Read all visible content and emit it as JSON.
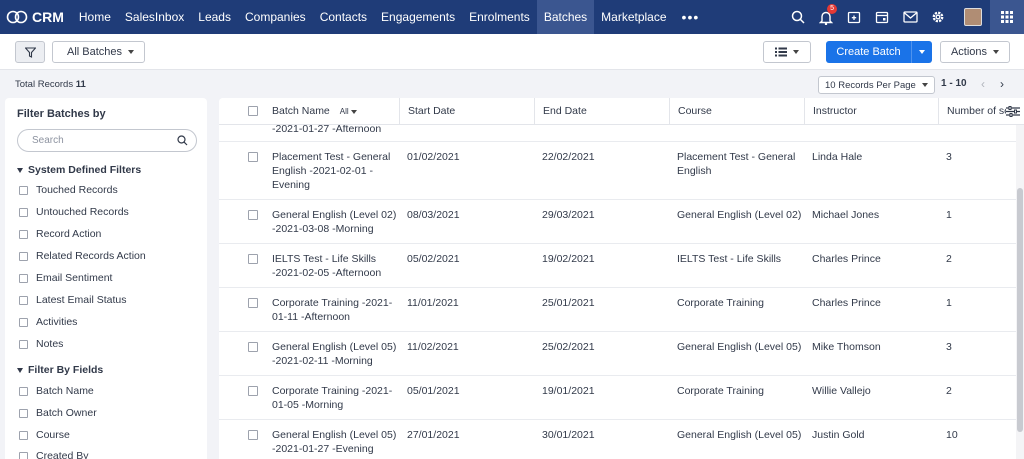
{
  "brand": {
    "name": "CRM"
  },
  "nav": {
    "items": [
      {
        "label": "Home",
        "active": false
      },
      {
        "label": "SalesInbox",
        "active": false
      },
      {
        "label": "Leads",
        "active": false
      },
      {
        "label": "Companies",
        "active": false
      },
      {
        "label": "Contacts",
        "active": false
      },
      {
        "label": "Engagements",
        "active": false
      },
      {
        "label": "Enrolments",
        "active": false
      },
      {
        "label": "Batches",
        "active": true
      },
      {
        "label": "Marketplace",
        "active": false
      }
    ],
    "more": "•••",
    "notification_count": "5",
    "icons": [
      "search-icon",
      "bell-icon",
      "add-calendar-icon",
      "calendar-icon",
      "mail-icon",
      "gear-icon",
      "avatar",
      "apps-grid-icon"
    ]
  },
  "toolbar": {
    "view_label": "All Batches",
    "create_label": "Create Batch",
    "actions_label": "Actions"
  },
  "subbar": {
    "total_label": "Total Records",
    "total_count": "11",
    "per_page": "10 Records Per Page",
    "range": "1 - 10"
  },
  "sidebar": {
    "title": "Filter Batches by",
    "search_placeholder": "Search",
    "group1": "System Defined Filters",
    "system_filters": [
      "Touched Records",
      "Untouched Records",
      "Record Action",
      "Related Records Action",
      "Email Sentiment",
      "Latest Email Status",
      "Activities",
      "Notes"
    ],
    "group2": "Filter By Fields",
    "field_filters": [
      "Batch Name",
      "Batch Owner",
      "Course",
      "Created By"
    ]
  },
  "table": {
    "columns": [
      "Batch Name",
      "Start Date",
      "End Date",
      "Course",
      "Instructor",
      "Number of se"
    ],
    "all_label": "All",
    "partial_row": "-2021-01-27 -Afternoon",
    "rows": [
      {
        "name1": "Placement Test - General",
        "name2": "English -2021-02-01 -",
        "name3": "Evening",
        "start": "01/02/2021",
        "end": "22/02/2021",
        "course1": "Placement Test - General",
        "course2": "English",
        "instructor": "Linda Hale",
        "sessions": "3"
      },
      {
        "name1": "General English (Level 02)",
        "name2": "-2021-03-08 -Morning",
        "name3": "",
        "start": "08/03/2021",
        "end": "29/03/2021",
        "course1": "General English (Level 02)",
        "course2": "",
        "instructor": "Michael Jones",
        "sessions": "1"
      },
      {
        "name1": "IELTS Test - Life Skills",
        "name2": "-2021-02-05 -Afternoon",
        "name3": "",
        "start": "05/02/2021",
        "end": "19/02/2021",
        "course1": "IELTS Test - Life Skills",
        "course2": "",
        "instructor": "Charles Prince",
        "sessions": "2"
      },
      {
        "name1": "Corporate Training -2021-",
        "name2": "01-11 -Afternoon",
        "name3": "",
        "start": "11/01/2021",
        "end": "25/01/2021",
        "course1": "Corporate Training",
        "course2": "",
        "instructor": "Charles Prince",
        "sessions": "1"
      },
      {
        "name1": "General English (Level 05)",
        "name2": "-2021-02-11 -Morning",
        "name3": "",
        "start": "11/02/2021",
        "end": "25/02/2021",
        "course1": "General English (Level 05)",
        "course2": "",
        "instructor": "Mike Thomson",
        "sessions": "3"
      },
      {
        "name1": "Corporate Training -2021-",
        "name2": "01-05 -Morning",
        "name3": "",
        "start": "05/01/2021",
        "end": "19/01/2021",
        "course1": "Corporate Training",
        "course2": "",
        "instructor": "Willie Vallejo",
        "sessions": "2"
      },
      {
        "name1": "General English (Level 05)",
        "name2": "-2021-01-27 -Evening",
        "name3": "",
        "start": "27/01/2021",
        "end": "30/01/2021",
        "course1": "General English (Level 05)",
        "course2": "",
        "instructor": "Justin Gold",
        "sessions": "10"
      }
    ]
  }
}
